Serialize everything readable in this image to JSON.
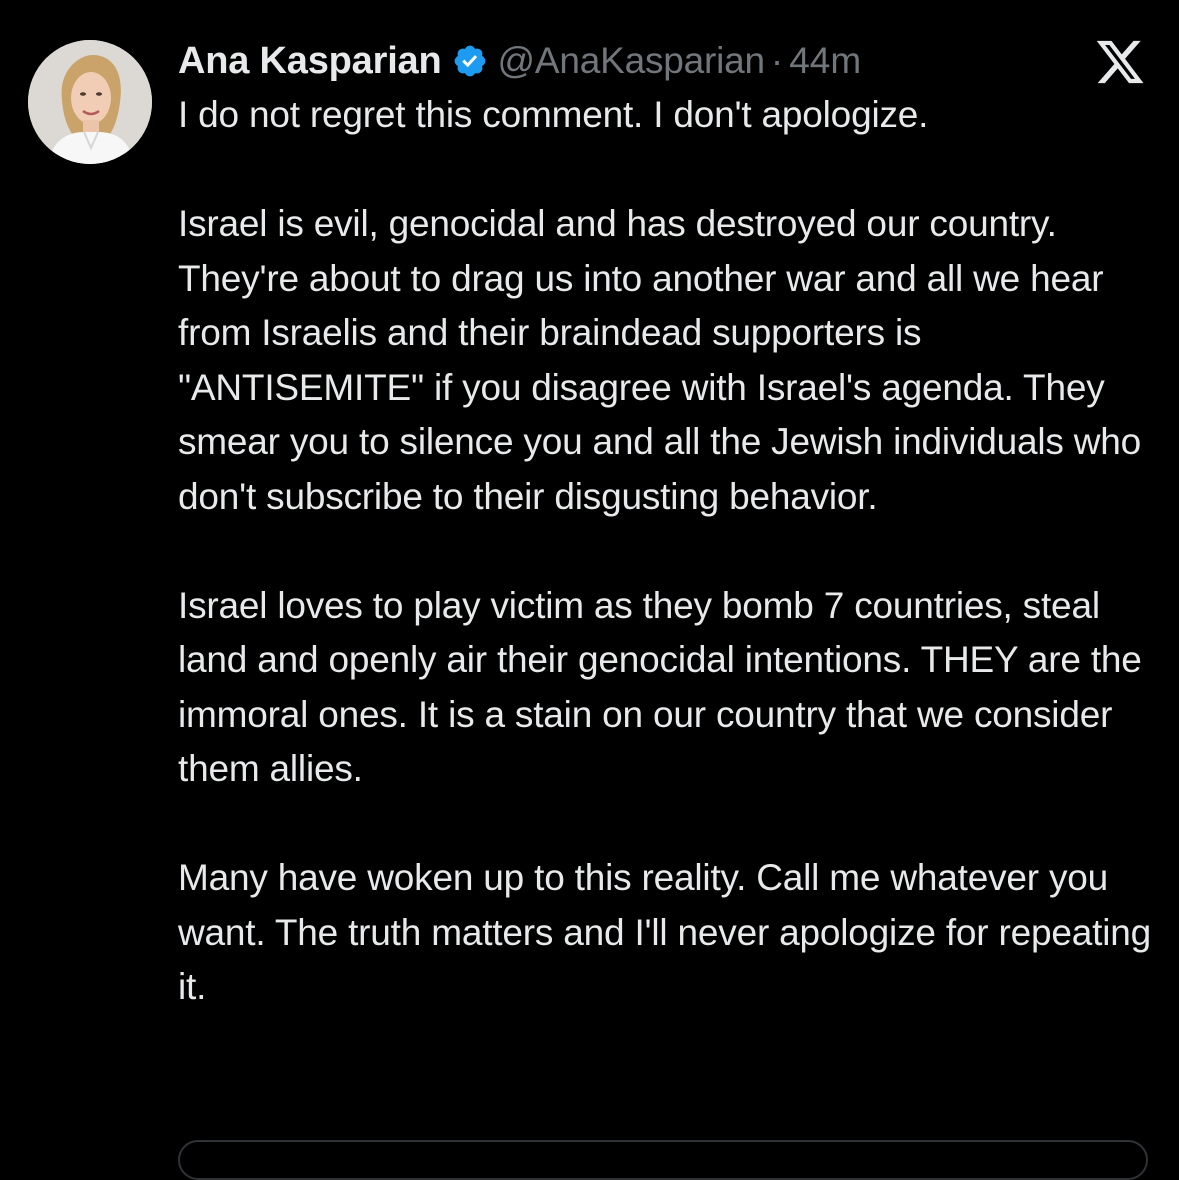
{
  "author": {
    "display_name": "Ana Kasparian",
    "handle": "@AnaKasparian",
    "separator": "·",
    "time": "44m",
    "verified": true
  },
  "icons": {
    "verified": "verified-badge-icon",
    "platform": "x-logo-icon",
    "avatar": "profile-avatar"
  },
  "colors": {
    "background": "#000000",
    "text": "#e7e9ea",
    "secondary": "#71767b",
    "verified_blue": "#1d9bf0"
  },
  "tweet": {
    "line_1": "I do not regret this comment. I don't apologize.",
    "para_2": "Israel is evil, genocidal and has destroyed our country. They're about to drag us into another war and all we hear from Israelis and their braindead supporters is \"ANTISEMITE\" if you disagree with Israel's agenda. They smear you to silence you and all the Jewish individuals who don't subscribe to their disgusting behavior.",
    "para_3": "Israel loves to play victim as they bomb 7 countries, steal land and openly air their genocidal intentions. THEY are the immoral ones. It is a stain on our country that we consider them allies.",
    "para_4": "Many have woken up to this reality. Call me whatever you want. The truth matters and I'll never apologize for repeating it."
  }
}
